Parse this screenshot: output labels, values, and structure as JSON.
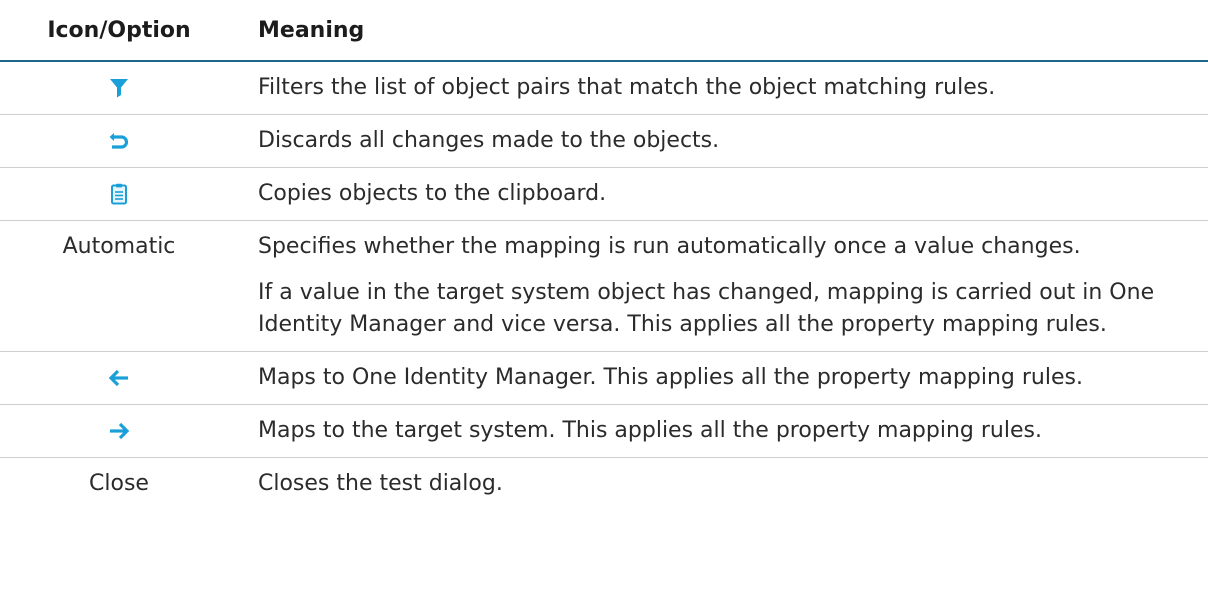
{
  "table": {
    "headers": {
      "icon": "Icon/Option",
      "meaning": "Meaning"
    },
    "rows": [
      {
        "icon": "filter-icon",
        "option": "",
        "meaning": [
          "Filters the list of object pairs that match the object matching rules."
        ]
      },
      {
        "icon": "undo-icon",
        "option": "",
        "meaning": [
          "Discards all changes made to the objects."
        ]
      },
      {
        "icon": "clipboard-icon",
        "option": "",
        "meaning": [
          "Copies objects to the clipboard."
        ]
      },
      {
        "icon": "",
        "option": "Automatic",
        "meaning": [
          "Specifies whether the mapping is run automatically once a value changes.",
          "If a value in the target system object has changed, mapping is carried out in One Identity Manager and vice versa. This applies all the property mapping rules."
        ]
      },
      {
        "icon": "arrow-left-icon",
        "option": "",
        "meaning": [
          "Maps to One Identity Manager. This applies all the property mapping rules."
        ]
      },
      {
        "icon": "arrow-right-icon",
        "option": "",
        "meaning": [
          "Maps to the target system. This applies all the property mapping rules."
        ]
      },
      {
        "icon": "",
        "option": "Close",
        "meaning": [
          "Closes the test dialog."
        ]
      }
    ]
  },
  "colors": {
    "icon_blue": "#1a9fd8",
    "header_rule": "#1f6689"
  }
}
